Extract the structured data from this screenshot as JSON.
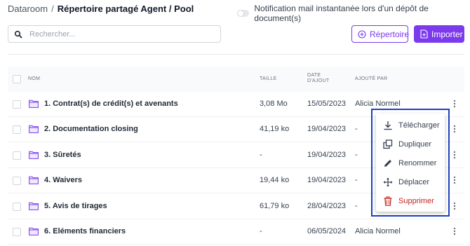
{
  "breadcrumb": {
    "root": "Dataroom",
    "separator": "/",
    "current": "Répertoire partagé Agent / Pool"
  },
  "notification": {
    "label": "Notification mail instantanée lors d'un dépôt de document(s)",
    "enabled": false
  },
  "search": {
    "placeholder": "Rechercher..."
  },
  "buttons": {
    "repertoire": "Répertoire",
    "importer": "Importer"
  },
  "table": {
    "headers": {
      "name": "NOM",
      "size": "TAILLE",
      "date_line1": "DATE",
      "date_line2": "D'AJOUT",
      "added_by": "AJOUTÉ PAR"
    },
    "rows": [
      {
        "name": "1. Contrat(s) de crédit(s) et avenants",
        "size": "3,08 Mo",
        "date": "15/05/2023",
        "added_by": "Alicia Normel"
      },
      {
        "name": "2. Documentation closing",
        "size": "41,19 ko",
        "date": "19/04/2023",
        "added_by": "-"
      },
      {
        "name": "3. Sûretés",
        "size": "-",
        "date": "19/04/2023",
        "added_by": "-"
      },
      {
        "name": "4. Waivers",
        "size": "19,44 ko",
        "date": "19/04/2023",
        "added_by": "-"
      },
      {
        "name": "5. Avis de tirages",
        "size": "61,79 ko",
        "date": "28/04/2023",
        "added_by": "-"
      },
      {
        "name": "6. Eléments financiers",
        "size": "-",
        "date": "06/05/2024",
        "added_by": "Alicia Normel"
      }
    ]
  },
  "context_menu": {
    "items": [
      {
        "label": "Télécharger",
        "icon": "download-icon"
      },
      {
        "label": "Dupliquer",
        "icon": "duplicate-icon"
      },
      {
        "label": "Renommer",
        "icon": "pencil-icon"
      },
      {
        "label": "Déplacer",
        "icon": "move-icon"
      },
      {
        "label": "Supprimer",
        "icon": "trash-icon"
      }
    ]
  },
  "colors": {
    "accent": "#7c3aed",
    "danger": "#c2261d",
    "highlight_frame": "#1d3fbf",
    "folder": "#7c3aed"
  }
}
